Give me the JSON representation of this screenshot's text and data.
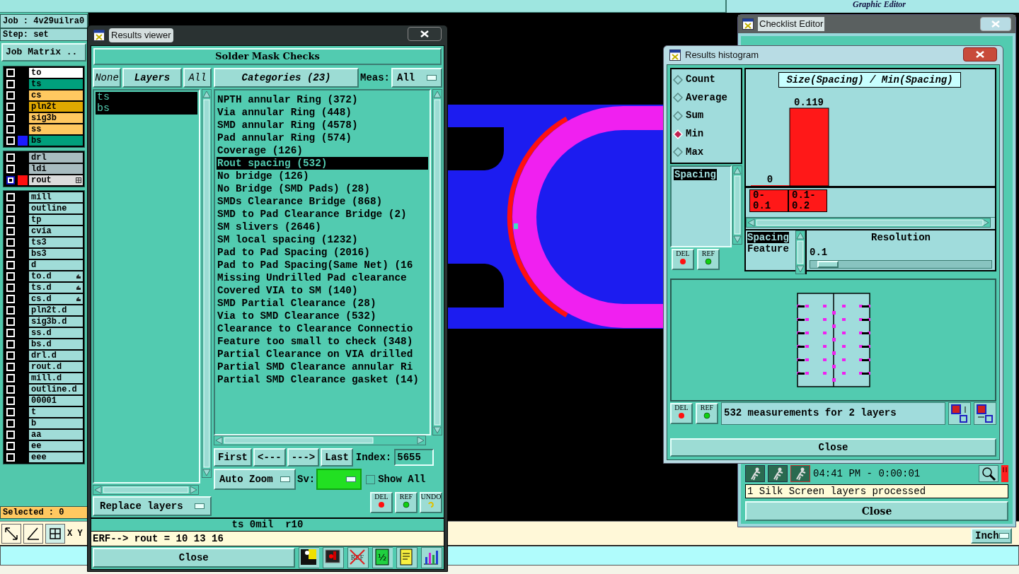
{
  "app": {
    "subtitle": "Graphic Editor",
    "coords_label": "X Y",
    "units": "Inch"
  },
  "job_panel": {
    "job": "Job : 4v29uilra0",
    "step": "Step: set",
    "matrix_button": "Job Matrix ..",
    "selected_count": "Selected : 0",
    "layer_groups": [
      {
        "layers": [
          {
            "name": "to",
            "color": "#ffffff",
            "active": false
          },
          {
            "name": "ts",
            "color": "#00a07c",
            "active": false
          },
          {
            "name": "cs",
            "color": "#ffc860",
            "active": false
          },
          {
            "name": "pln2t",
            "color": "#e0a800",
            "active": false
          },
          {
            "name": "sig3b",
            "color": "#ffc860",
            "active": false
          },
          {
            "name": "ss",
            "color": "#ffc860",
            "active": false
          },
          {
            "name": "bs",
            "color": "#00a07c",
            "active": false,
            "swatch": {
              "color": "#1c1cff"
            }
          }
        ]
      },
      {
        "layers": [
          {
            "name": "drl",
            "color": "#a8bcc0",
            "active": false
          },
          {
            "name": "ldi",
            "color": "#a8bcc0",
            "active": false
          },
          {
            "name": "rout",
            "color": "#dcdcdc",
            "active": true,
            "swatch": {
              "color": "#ff1010"
            },
            "badge": {
              "kind": "expand"
            }
          }
        ]
      },
      {
        "layers": [
          {
            "name": "mill",
            "color": "#a0dcd8",
            "active": false
          },
          {
            "name": "outline",
            "color": "#a0dcd8",
            "active": false
          },
          {
            "name": "tp",
            "color": "#a0dcd8",
            "active": false
          },
          {
            "name": "cvia",
            "color": "#a0dcd8",
            "active": false
          },
          {
            "name": "ts3",
            "color": "#a0dcd8",
            "active": false
          },
          {
            "name": "bs3",
            "color": "#a0dcd8",
            "active": false
          },
          {
            "name": "d",
            "color": "#a0dcd8",
            "active": false
          },
          {
            "name": "to.d",
            "color": "#a0dcd8",
            "active": false,
            "badge": {
              "kind": "hand"
            }
          },
          {
            "name": "ts.d",
            "color": "#a0dcd8",
            "active": false,
            "badge": {
              "kind": "hand"
            }
          },
          {
            "name": "cs.d",
            "color": "#a0dcd8",
            "active": false,
            "badge": {
              "kind": "hand"
            }
          },
          {
            "name": "pln2t.d",
            "color": "#a0dcd8",
            "active": false
          },
          {
            "name": "sig3b.d",
            "color": "#a0dcd8",
            "active": false
          },
          {
            "name": "ss.d",
            "color": "#a0dcd8",
            "active": false
          },
          {
            "name": "bs.d",
            "color": "#a0dcd8",
            "active": false
          },
          {
            "name": "drl.d",
            "color": "#a0dcd8",
            "active": false
          },
          {
            "name": "rout.d",
            "color": "#a0dcd8",
            "active": false
          },
          {
            "name": "mill.d",
            "color": "#a0dcd8",
            "active": false
          },
          {
            "name": "outline.d",
            "color": "#a0dcd8",
            "active": false
          },
          {
            "name": "00001",
            "color": "#a0dcd8",
            "active": false
          },
          {
            "name": "t",
            "color": "#a0dcd8",
            "active": false
          },
          {
            "name": "b",
            "color": "#a0dcd8",
            "active": false
          },
          {
            "name": "aa",
            "color": "#a0dcd8",
            "active": false
          },
          {
            "name": "ee",
            "color": "#a0dcd8",
            "active": false
          },
          {
            "name": "eee",
            "color": "#a0dcd8",
            "active": false
          }
        ]
      }
    ]
  },
  "results_viewer": {
    "title": "Results viewer",
    "header": "Solder Mask Checks",
    "layer_buttons": [
      "None",
      "Layers",
      "All"
    ],
    "layers": [
      {
        "name": "ts",
        "selected": true
      },
      {
        "name": "bs",
        "selected": true
      }
    ],
    "categories_header": "Categories (23)",
    "meas_label": "Meas:",
    "meas_value": "All",
    "categories": [
      {
        "label": "NPTH annular Ring (372)",
        "selected": false
      },
      {
        "label": "Via annular Ring (448)",
        "selected": false
      },
      {
        "label": "SMD annular Ring (4578)",
        "selected": false
      },
      {
        "label": "Pad annular Ring (574)",
        "selected": false
      },
      {
        "label": "Coverage (126)",
        "selected": false
      },
      {
        "label": "Rout spacing (532)",
        "selected": true
      },
      {
        "label": "No bridge (126)",
        "selected": false
      },
      {
        "label": "No Bridge (SMD Pads) (28)",
        "selected": false
      },
      {
        "label": "SMDs Clearance Bridge (868)",
        "selected": false
      },
      {
        "label": "SMD to Pad Clearance Bridge (2)",
        "selected": false
      },
      {
        "label": "SM slivers (2646)",
        "selected": false
      },
      {
        "label": "SM local spacing (1232)",
        "selected": false
      },
      {
        "label": "Pad to Pad Spacing (2016)",
        "selected": false
      },
      {
        "label": "Pad to Pad Spacing(Same Net) (16",
        "selected": false
      },
      {
        "label": "Missing Undrilled Pad clearance",
        "selected": false
      },
      {
        "label": "Covered VIA to SM (140)",
        "selected": false
      },
      {
        "label": "SMD Partial Clearance (28)",
        "selected": false
      },
      {
        "label": "Via to SMD Clearance (532)",
        "selected": false
      },
      {
        "label": "Clearance to Clearance Connectio",
        "selected": false
      },
      {
        "label": "Feature too small to check (348)",
        "selected": false
      },
      {
        "label": "Partial Clearance on VIA drilled",
        "selected": false
      },
      {
        "label": "Partial SMD Clearance annular Ri",
        "selected": false
      },
      {
        "label": "Partial SMD Clearance gasket (14)",
        "selected": false
      }
    ],
    "nav": [
      "First",
      "<---",
      "--->",
      "Last"
    ],
    "index_label": "Index:",
    "index_value": "5655",
    "zoom_mode": "Auto Zoom",
    "sv_label": "Sv:",
    "sv": {
      "color": "#22e022"
    },
    "show_all": {
      "label": "Show All",
      "checked": false
    },
    "replace_mode": "Replace layers",
    "actions": [
      {
        "kind": "del",
        "label": "DEL"
      },
      {
        "kind": "ref",
        "label": "REF"
      },
      {
        "kind": "undo",
        "label": "UNDO"
      }
    ],
    "status": "ts 0mil  r10",
    "command": "ERF--> rout = 10 13 16",
    "close": "Close",
    "tools": [
      {
        "kind": "person"
      },
      {
        "kind": "monitor"
      },
      {
        "kind": "noref",
        "label": "REF"
      },
      {
        "kind": "half",
        "label": "½"
      },
      {
        "kind": "note"
      },
      {
        "kind": "chart"
      }
    ]
  },
  "histogram": {
    "title": "Results histogram",
    "modes": [
      {
        "label": "Count",
        "selected": false
      },
      {
        "label": "Average",
        "selected": false
      },
      {
        "label": "Sum",
        "selected": false
      },
      {
        "label": "Min",
        "selected": true
      },
      {
        "label": "Max",
        "selected": false
      }
    ],
    "attributes": [
      {
        "label": "Spacing",
        "selected": true
      }
    ],
    "list_actions": [
      {
        "kind": "del",
        "label": "DEL"
      },
      {
        "kind": "ref",
        "label": "REF"
      }
    ],
    "chart_data": {
      "type": "bar",
      "title": "Size(Spacing) / Min(Spacing)",
      "categories": [
        "0-0.1",
        "0.1-0.2"
      ],
      "values": [
        0,
        0.119
      ],
      "value_labels": [
        "0",
        "0.119"
      ]
    },
    "group_by": [
      {
        "label": "Spacing",
        "selected": true
      },
      {
        "label": "Feature",
        "selected": false
      }
    ],
    "resolution_label": "Resolution",
    "resolution_value": "0.1",
    "resolution_slider": {
      "level": 0.04
    },
    "footer_actions": [
      {
        "kind": "del",
        "label": "DEL"
      },
      {
        "kind": "ref",
        "label": "REF"
      }
    ],
    "summary": "532 measurements for 2 layers",
    "close": "Close"
  },
  "checklist_editor": {
    "title": "Checklist Editor",
    "time": "04:41 PM - 0:00:01",
    "message": "1 Silk Screen layers processed",
    "close": "Close"
  }
}
